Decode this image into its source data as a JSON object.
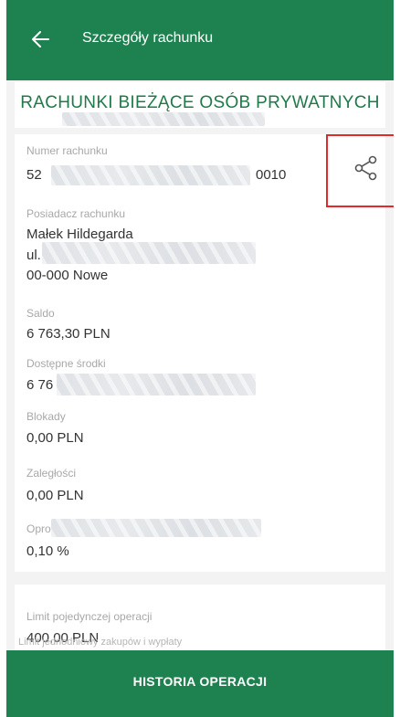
{
  "appbar": {
    "title": "Szczegóły rachunku",
    "back_icon": "arrow-left-icon"
  },
  "header": {
    "account_type": "RACHUNKI BIEŻĄCE OSÓB PRYWATNYCH"
  },
  "details": {
    "account_number_label": "Numer rachunku",
    "account_number_prefix": "52",
    "account_number_suffix": "0010",
    "owner_label": "Posiadacz rachunku",
    "owner_name": "Małek Hildegarda",
    "owner_street_prefix": "ul.",
    "owner_city": "00-000 Nowe",
    "balance_label": "Saldo",
    "balance_value": "6 763,30 PLN",
    "available_label": "Dostępne środki",
    "available_value_prefix": "6 76",
    "blocks_label": "Blokady",
    "blocks_value": "0,00 PLN",
    "arrears_label": "Zaległości",
    "arrears_value": "0,00 PLN",
    "interest_label_prefix": "Opro",
    "interest_value": "0,10 %",
    "share_icon": "share-icon"
  },
  "limits": {
    "single_op_label": "Limit pojedynczej operacji",
    "single_op_value": "400,00 PLN",
    "partial_label": "Limit jednodniowy zakupów i wypłaty"
  },
  "footer": {
    "history_button": "HISTORIA OPERACJI"
  },
  "colors": {
    "brand_green": "#1e8250",
    "highlight_red": "#e22a2a"
  }
}
